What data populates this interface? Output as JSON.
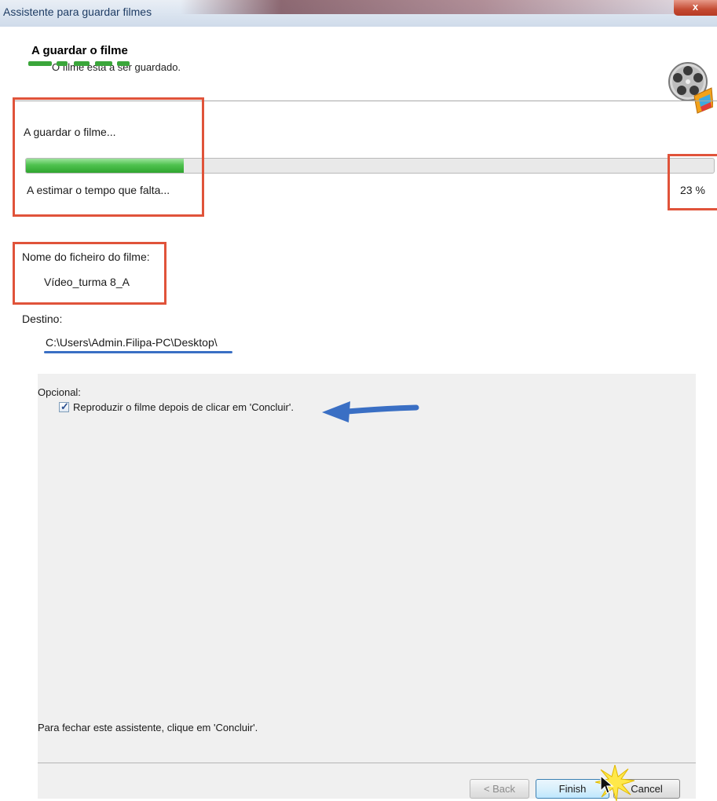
{
  "window": {
    "title": "Assistente para guardar filmes",
    "close_glyph": "x"
  },
  "header": {
    "title": "A guardar o filme",
    "subtitle": "O filme está a ser guardado.",
    "icon": "film-reel-icon"
  },
  "progress": {
    "status_label": "A guardar o filme...",
    "estimate_label": "A estimar o tempo que falta...",
    "percent_label": "23 %",
    "percent_value": 23
  },
  "file": {
    "name_label": "Nome do ficheiro do filme:",
    "name_value": "Vídeo_turma 8_A",
    "destination_label": "Destino:",
    "destination_value": "C:\\Users\\Admin.Filipa-PC\\Desktop\\"
  },
  "options": {
    "optional_label": "Opcional:",
    "play_after_label": "Reproduzir o filme depois de clicar em 'Concluir'.",
    "play_after_checked": true
  },
  "footer": {
    "close_hint": "Para fechar este assistente, clique em 'Concluir'.",
    "back_label": "< Back",
    "finish_label": "Finish",
    "cancel_label": "Cancel"
  },
  "colors": {
    "annotation_red": "#e0533a",
    "annotation_blue": "#3a6fc4",
    "progress_green": "#3fb43f",
    "highlight_green": "#3aa63a"
  }
}
